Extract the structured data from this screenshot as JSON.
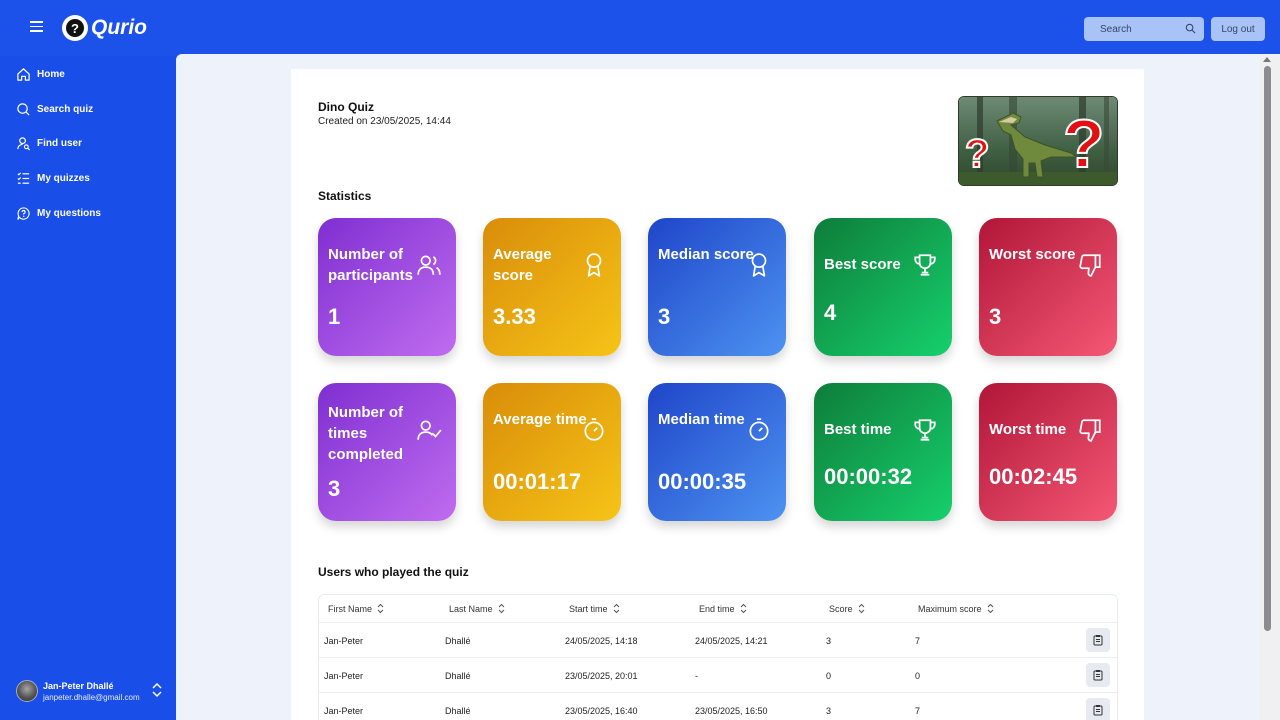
{
  "app": {
    "brand": "Qurio"
  },
  "header": {
    "search_placeholder": "Search",
    "logout_label": "Log out"
  },
  "sidebar": {
    "items": [
      {
        "label": "Home",
        "icon": "home-icon"
      },
      {
        "label": "Search quiz",
        "icon": "search-icon"
      },
      {
        "label": "Find user",
        "icon": "user-search-icon"
      },
      {
        "label": "My quizzes",
        "icon": "list-icon"
      },
      {
        "label": "My questions",
        "icon": "question-chat-icon"
      }
    ],
    "user": {
      "name": "Jan-Peter Dhallé",
      "email": "janpeter.dhalle@gmail.com"
    }
  },
  "quiz": {
    "title": "Dino Quiz",
    "created": "Created on 23/05/2025, 14:44"
  },
  "statistics": {
    "title": "Statistics",
    "cards": [
      {
        "label": "Number of participants",
        "value": "1",
        "color": "#7f2fd1",
        "icon": "users-icon"
      },
      {
        "label": "Average score",
        "value": "3.33",
        "color": "#d98d0a",
        "icon": "award-icon"
      },
      {
        "label": "Median score",
        "value": "3",
        "color": "#1f45c9",
        "icon": "award-icon"
      },
      {
        "label": "Best score",
        "value": "4",
        "color": "#0e7d3a",
        "icon": "trophy-icon"
      },
      {
        "label": "Worst score",
        "value": "3",
        "color": "#b11638",
        "icon": "thumbs-down-icon"
      },
      {
        "label": "Number of times completed",
        "value": "3",
        "color": "#7f2fd1",
        "icon": "user-check-icon"
      },
      {
        "label": "Average time",
        "value": "00:01:17",
        "color": "#d98d0a",
        "icon": "timer-icon"
      },
      {
        "label": "Median time",
        "value": "00:00:35",
        "color": "#1f45c9",
        "icon": "timer-icon"
      },
      {
        "label": "Best time",
        "value": "00:00:32",
        "color": "#0e7d3a",
        "icon": "trophy-icon"
      },
      {
        "label": "Worst time",
        "value": "00:02:45",
        "color": "#b11638",
        "icon": "thumbs-down-icon"
      }
    ]
  },
  "players": {
    "title": "Users who played the quiz",
    "columns": [
      "First Name",
      "Last Name",
      "Start time",
      "End time",
      "Score",
      "Maximum score"
    ],
    "rows": [
      [
        "Jan-Peter",
        "Dhallé",
        "24/05/2025, 14:18",
        "24/05/2025, 14:21",
        "3",
        "7"
      ],
      [
        "Jan-Peter",
        "Dhallé",
        "23/05/2025, 20:01",
        "-",
        "0",
        "0"
      ],
      [
        "Jan-Peter",
        "Dhallé",
        "23/05/2025, 16:40",
        "23/05/2025, 16:50",
        "3",
        "7"
      ]
    ]
  }
}
